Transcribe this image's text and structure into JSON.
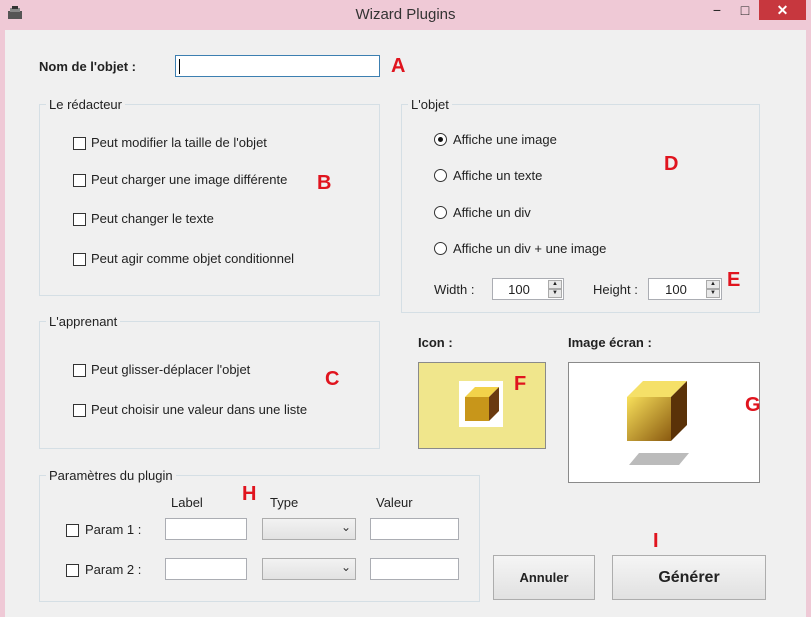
{
  "window": {
    "title": "Wizard Plugins",
    "minimize": "−",
    "maximize": "□",
    "close": "✕",
    "app_icon": "toolbox-icon"
  },
  "object_name": {
    "label": "Nom de l'objet :",
    "value": "",
    "marker": "A"
  },
  "redacteur": {
    "legend": "Le rédacteur",
    "marker": "B",
    "options": [
      {
        "label": "Peut modifier la taille de l'objet",
        "checked": false
      },
      {
        "label": "Peut charger une image différente",
        "checked": false
      },
      {
        "label": "Peut changer le texte",
        "checked": false
      },
      {
        "label": "Peut agir comme objet conditionnel",
        "checked": false
      }
    ]
  },
  "apprenant": {
    "legend": "L'apprenant",
    "marker": "C",
    "options": [
      {
        "label": "Peut glisser-déplacer l'objet",
        "checked": false
      },
      {
        "label": "Peut choisir une valeur dans une liste",
        "checked": false
      }
    ]
  },
  "objet": {
    "legend": "L'objet",
    "marker": "D",
    "options": [
      {
        "label": "Affiche une image",
        "selected": true
      },
      {
        "label": "Affiche un texte",
        "selected": false
      },
      {
        "label": "Affiche un div",
        "selected": false
      },
      {
        "label": "Affiche un div + une image",
        "selected": false
      }
    ],
    "width_label": "Width :",
    "width_value": "100",
    "height_label": "Height :",
    "height_value": "100",
    "size_marker": "E"
  },
  "icon": {
    "label": "Icon :",
    "marker": "F",
    "bg": "#f0e68c"
  },
  "screen_image": {
    "label": "Image écran :",
    "marker": "G"
  },
  "plugin_params": {
    "legend": "Paramètres du plugin",
    "marker": "H",
    "col_label": "Label",
    "col_type": "Type",
    "col_value": "Valeur",
    "rows": [
      {
        "name": "Param 1 :",
        "checked": false,
        "label": "",
        "type": "",
        "value": ""
      },
      {
        "name": "Param 2 :",
        "checked": false,
        "label": "",
        "type": "",
        "value": ""
      }
    ]
  },
  "buttons": {
    "cancel": "Annuler",
    "generate": "Générer",
    "marker": "I"
  },
  "colors": {
    "marker": "#e0141e",
    "titlebar": "#efc9d6",
    "close": "#c7373e"
  }
}
